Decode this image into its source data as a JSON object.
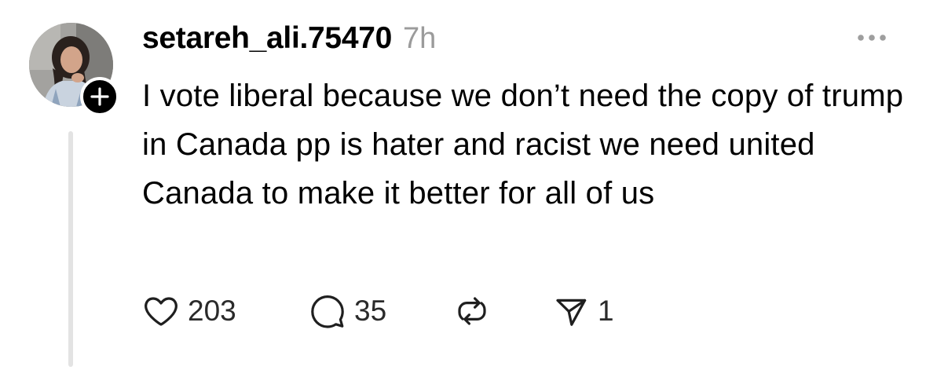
{
  "post": {
    "username": "setareh_ali.75470",
    "timestamp": "7h",
    "text": "I vote liberal because we don’t need the copy of trump in Canada pp is hater and racist we need united Canada to make it better for all of us"
  },
  "actions": {
    "likes": "203",
    "replies": "35",
    "shares": "1"
  },
  "icons": {
    "like": "heart-icon",
    "reply": "speech-bubble-icon",
    "repost": "repost-icon",
    "share": "send-icon",
    "more": "more-horizontal-icon",
    "follow": "plus-icon"
  }
}
